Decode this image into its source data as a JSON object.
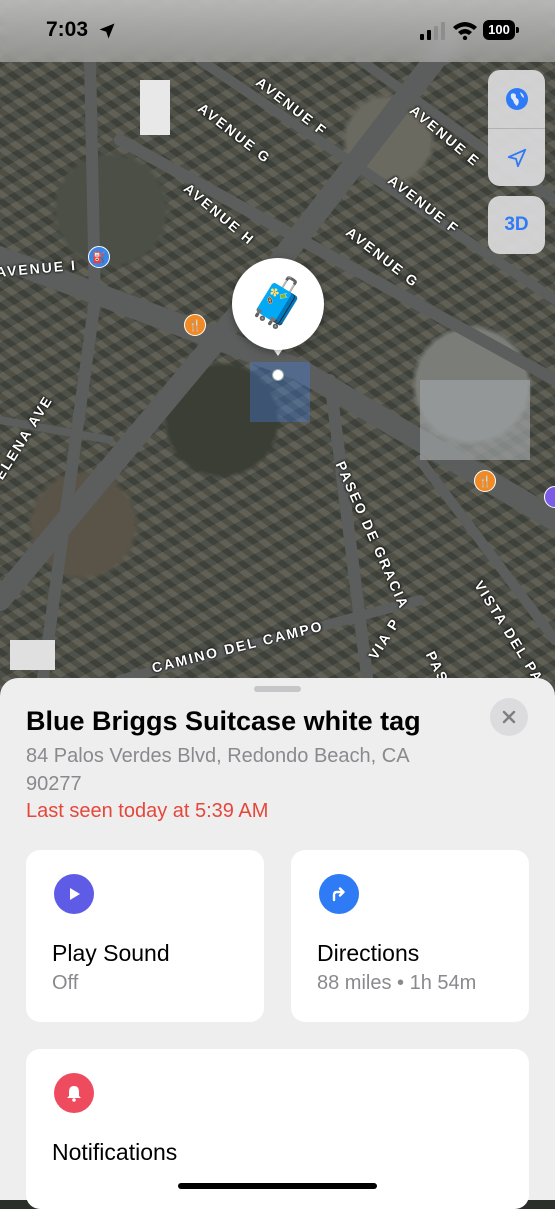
{
  "status_bar": {
    "time": "7:03",
    "battery": "100"
  },
  "map": {
    "road_labels": [
      "AVENUE F",
      "AVENUE G",
      "AVENUE H",
      "AVENUE E",
      "AVENUE F",
      "AVENUE G",
      "AVENUE I",
      "ELENA AVE",
      "PASEO DE GRACIA",
      "VISTA DEL PAR",
      "CAMINO DEL CAMPO",
      "VIA P",
      "PASEO"
    ],
    "controls": {
      "globe_icon": "globe-icon",
      "location_icon": "location-arrow-icon",
      "three_d_label": "3D"
    },
    "pin_emoji": "🧳",
    "accent_color": "#2f7bf5"
  },
  "sheet": {
    "title": "Blue Briggs Suitcase white tag",
    "address": "84 Palos Verdes Blvd, Redondo Beach, CA  90277",
    "last_seen": "Last seen today at 5:39 AM",
    "last_seen_color": "#e5473c",
    "cards": {
      "play_sound": {
        "title": "Play Sound",
        "subtitle": "Off",
        "icon": "play-icon",
        "icon_color": "#5e5ce6"
      },
      "directions": {
        "title": "Directions",
        "subtitle": "88 miles • 1h 54m",
        "icon": "directions-arrow-icon",
        "icon_color": "#2f7bf5"
      },
      "notifications": {
        "title": "Notifications",
        "icon": "bell-icon",
        "icon_color": "#ef4b5f"
      }
    }
  }
}
